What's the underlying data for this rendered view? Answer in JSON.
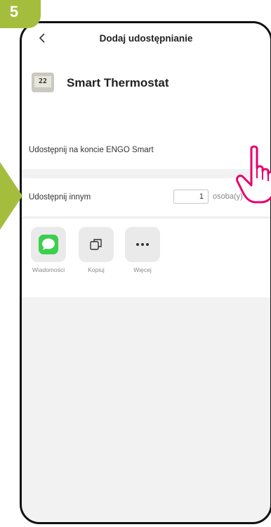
{
  "step_badge": "5",
  "header": {
    "title": "Dodaj udostępnianie"
  },
  "device": {
    "screen_text": "22",
    "name": "Smart Thermostat"
  },
  "share_account": {
    "label": "Udostępnij na koncie ENGO Smart"
  },
  "share_others": {
    "label": "Udostępnij innym",
    "count": "1",
    "unit": "osoba(y)"
  },
  "share_options": [
    {
      "label": "Wiadomości",
      "icon": "messages-icon"
    },
    {
      "label": "Kopiuj",
      "icon": "copy-icon"
    },
    {
      "label": "Więcej",
      "icon": "more-icon"
    }
  ],
  "colors": {
    "accent": "#a5bd3c",
    "messages_green": "#3ccf4e"
  }
}
